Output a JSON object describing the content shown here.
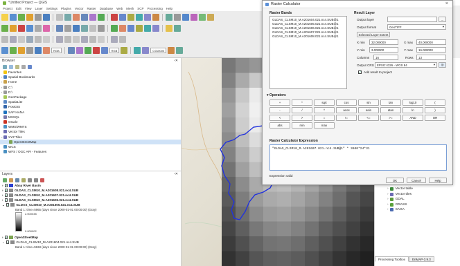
{
  "window": {
    "title": "*Untitled Project — QGIS"
  },
  "menu": [
    "Project",
    "Edit",
    "View",
    "Layer",
    "Settings",
    "Plugins",
    "Vector",
    "Raster",
    "Database",
    "Web",
    "Mesh",
    "SCP",
    "Processing",
    "Help"
  ],
  "toolbar": {
    "scale_value": "0.010000",
    "combo1": "RGB",
    "combo2": "RGB"
  },
  "browser": {
    "title": "Browser",
    "items": [
      {
        "label": "Favorites",
        "arrow": "",
        "color": "#f2c40f"
      },
      {
        "label": "Spatial Bookmarks",
        "arrow": "›",
        "color": "#4e7fbf"
      },
      {
        "label": "Home",
        "arrow": "›",
        "color": "#c9a14a"
      },
      {
        "label": "C:\\",
        "arrow": "›",
        "color": "#999999"
      },
      {
        "label": "D:\\",
        "arrow": "›",
        "color": "#999999"
      },
      {
        "label": "GeoPackage",
        "arrow": "",
        "color": "#a3c754"
      },
      {
        "label": "SpatiaLite",
        "arrow": "",
        "color": "#5a88c5"
      },
      {
        "label": "PostGIS",
        "arrow": "",
        "color": "#3366aa"
      },
      {
        "label": "SAP HANA",
        "arrow": "",
        "color": "#1e73be"
      },
      {
        "label": "MSSQL",
        "arrow": "",
        "color": "#7777aa"
      },
      {
        "label": "Oracle",
        "arrow": "",
        "color": "#cc3322"
      },
      {
        "label": "WMS/WMTS",
        "arrow": "",
        "color": "#4a90c2"
      },
      {
        "label": "Vector Tiles",
        "arrow": "",
        "color": "#6b6bb3"
      },
      {
        "label": "XYZ Tiles",
        "arrow": "⌄",
        "color": "#6b6bb3"
      },
      {
        "label": "OpenStreetMap",
        "arrow": "",
        "color": "#7da453"
      },
      {
        "label": "WCS",
        "arrow": "",
        "color": "#4a90c2"
      },
      {
        "label": "WFS / OGC API - Features",
        "arrow": "",
        "color": "#4a90c2"
      }
    ]
  },
  "layers": {
    "title": "Layers",
    "rows": [
      {
        "label": "Abay River Basin",
        "bold": true,
        "color": "#2a3fd1"
      },
      {
        "label": "GLDAS_CLSM10_M.A201608.021.nc4.SUB",
        "bold": true,
        "color": "#8a8a8a"
      },
      {
        "label": "GLDAS_CLSM10_M.A201607.021.nc4.SUB",
        "bold": true,
        "color": "#8a8a8a"
      },
      {
        "label": "GLDAS_CLSM10_M.A201606.021.nc4.SUB",
        "bold": true,
        "color": "#8a8a8a"
      },
      {
        "label": "GLDAS_CLSM10_M.A201605.021.nc4.SUB",
        "bold": true,
        "color": "#8a8a8a"
      }
    ],
    "band_label": "Band 1: time=5965 (days since 2000-01-01 00:00:00) (Gray)",
    "legend_max": "2.000038",
    "legend_min": "0.000002",
    "rows_bottom": [
      {
        "label": "OpenStreetMap",
        "bold": true,
        "color": "#7da453"
      },
      {
        "label": "GLDAS_CLSM10_M.A201604.021.nc4.SUB",
        "bold": false,
        "color": "#8a8a8a"
      }
    ],
    "band_label2": "Band 1: time=5933 (days since 2000-01-01 00:00:00) (Gray)"
  },
  "right_panel": {
    "items": [
      {
        "label": "Vector table",
        "color": "#3c8a3c"
      },
      {
        "label": "Vector tiles",
        "color": "#6b6bb3"
      },
      {
        "label": "GDAL",
        "color": "#5a9a3a"
      },
      {
        "label": "GRASS",
        "color": "#5aa03a"
      },
      {
        "label": "SAGA",
        "color": "#4a6ab0"
      }
    ],
    "tabs": [
      "Processing Toolbox",
      "EnMAP-3.9.3"
    ]
  },
  "dialog": {
    "title": "Raster Calculator",
    "raster_bands_title": "Raster Bands",
    "bands": [
      "GLDAS_CLSM10_M.A201604.021.nc4.SUB@1",
      "GLDAS_CLSM10_M.A201605.021.nc4.SUB@1",
      "GLDAS_CLSM10_M.A201606.021.nc4.SUB@1",
      "GLDAS_CLSM10_M.A201607.021.nc4.SUB@1",
      "GLDAS_CLSM10_M.A201608.021.nc4.SUB@1"
    ],
    "result_layer_title": "Result Layer",
    "output_layer_label": "Output layer",
    "output_layer_value": "",
    "browse_button": "...",
    "output_format_label": "Output format",
    "output_format_value": "GeoTIFF",
    "selected_extent_button": "Selected Layer Extent",
    "xmin_label": "X min",
    "xmin_value": "32.000000",
    "xmax_label": "X max",
    "xmax_value": "40.000000",
    "ymin_label": "Y min",
    "ymin_value": "3.000000",
    "ymax_label": "Y max",
    "ymax_value": "16.000000",
    "columns_label": "Columns",
    "columns_value": "16",
    "rows_label": "Rows",
    "rows_value": "13",
    "crs_label": "Output CRS",
    "crs_value": "EPSG:4326 - WGS 84",
    "add_result_label": "Add result to project",
    "operators_title": "Operators",
    "operators": [
      [
        "+",
        "*",
        "sqrt",
        "cos",
        "sin",
        "tan",
        "log10",
        "("
      ],
      [
        "-",
        "/",
        "^",
        "acos",
        "asin",
        "atan",
        "ln",
        ")"
      ],
      [
        "<",
        ">",
        "=",
        "!=",
        "<=",
        ">=",
        "AND",
        "OR"
      ],
      [
        "abs",
        "min",
        "max"
      ]
    ],
    "expression_title": "Raster Calculator Expression",
    "expression": "\"GLDAS_CLSM10_M.A201607.021.nc4.SUB@1\" * 3600*24*31",
    "expression_status": "Expression valid",
    "ok": "OK",
    "cancel": "Cancel",
    "help": "Help"
  }
}
